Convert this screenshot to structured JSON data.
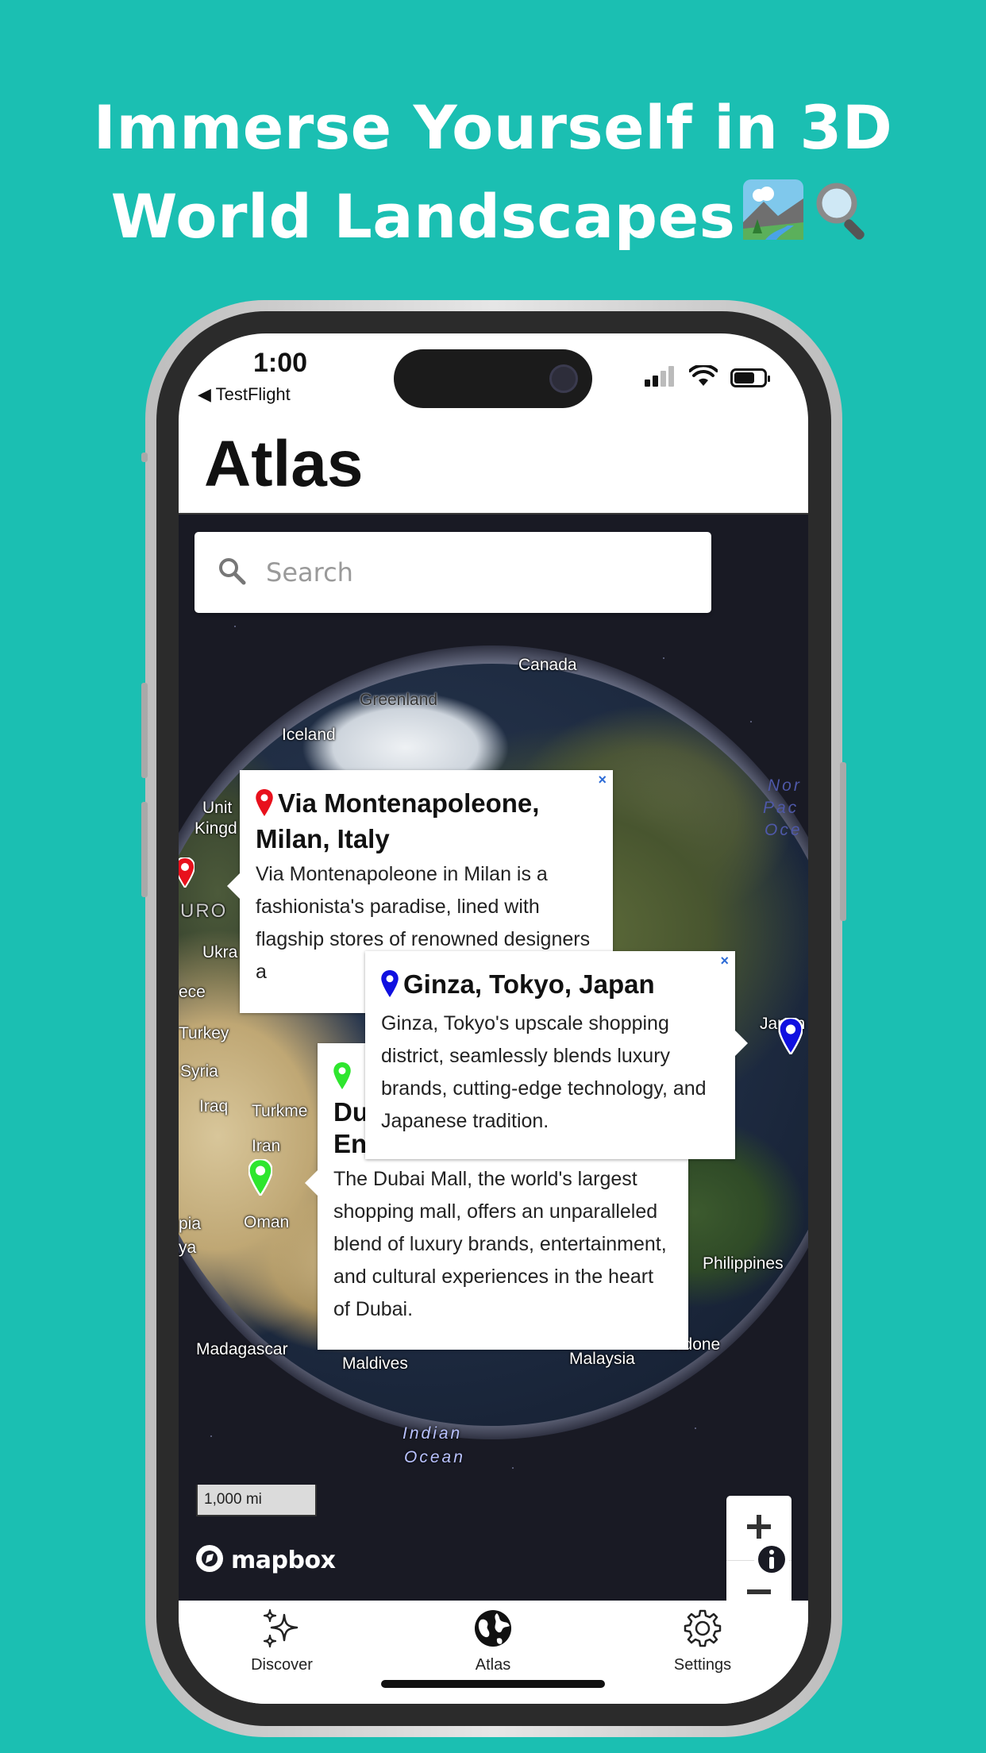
{
  "headline": {
    "line1": "Immerse Yourself in 3D",
    "line2": "World Landscapes"
  },
  "status_bar": {
    "time": "1:00",
    "back_label": "◀ TestFlight"
  },
  "nav": {
    "title": "Atlas"
  },
  "search": {
    "placeholder": "Search"
  },
  "map": {
    "labels": {
      "canada": "Canada",
      "greenland": "Greenland",
      "iceland": "Iceland",
      "united_kingdom_1": "Unit",
      "united_kingdom_2": "Kingd",
      "europe": "URO",
      "ukraine": "Ukra",
      "greece": "ece",
      "turkey": "Turkey",
      "syria": "Syria",
      "iraq": "Iraq",
      "turkmenistan": "Turkme",
      "iran": "Iran",
      "oman": "Oman",
      "ethiopia": "pia",
      "kenya": "ya",
      "madagascar": "Madagascar",
      "maldives": "Maldives",
      "malaysia": "Malaysia",
      "indonesia": "Indone",
      "philippines": "Philippines",
      "japan": "Japan",
      "north_pacific_1": "Nor",
      "north_pacific_2": "Pac",
      "north_pacific_3": "Oce",
      "indian_ocean_1": "Indian",
      "indian_ocean_2": "Ocean"
    },
    "scale_label": "1,000 mi",
    "attribution": "mapbox"
  },
  "popups": {
    "milan": {
      "title": "Via Montenapoleone, Milan, Italy",
      "description": "Via Montenapoleone in Milan is a fashionista's paradise, lined with flagship stores of renowned designers a"
    },
    "tokyo": {
      "title": "Ginza, Tokyo, Japan",
      "description": "Ginza, Tokyo's upscale shopping district, seamlessly blends luxury brands, cutting-edge technology, and Japanese tradition."
    },
    "dubai": {
      "title_1": "Du",
      "title_2": "En",
      "description": "The Dubai Mall, the world's largest shopping mall, offers an unparalleled blend of luxury brands, entertainment, and cultural experiences in the heart of Dubai."
    },
    "close_glyph": "×"
  },
  "pin_colors": {
    "milan": "#e8101c",
    "tokyo": "#1010e0",
    "dubai": "#2ee62e"
  },
  "tabs": [
    {
      "label": "Discover",
      "icon": "sparkles-icon"
    },
    {
      "label": "Atlas",
      "icon": "globe-icon"
    },
    {
      "label": "Settings",
      "icon": "gear-icon"
    }
  ],
  "colors": {
    "background": "#1bbfb2",
    "map_bg": "#191a24"
  }
}
